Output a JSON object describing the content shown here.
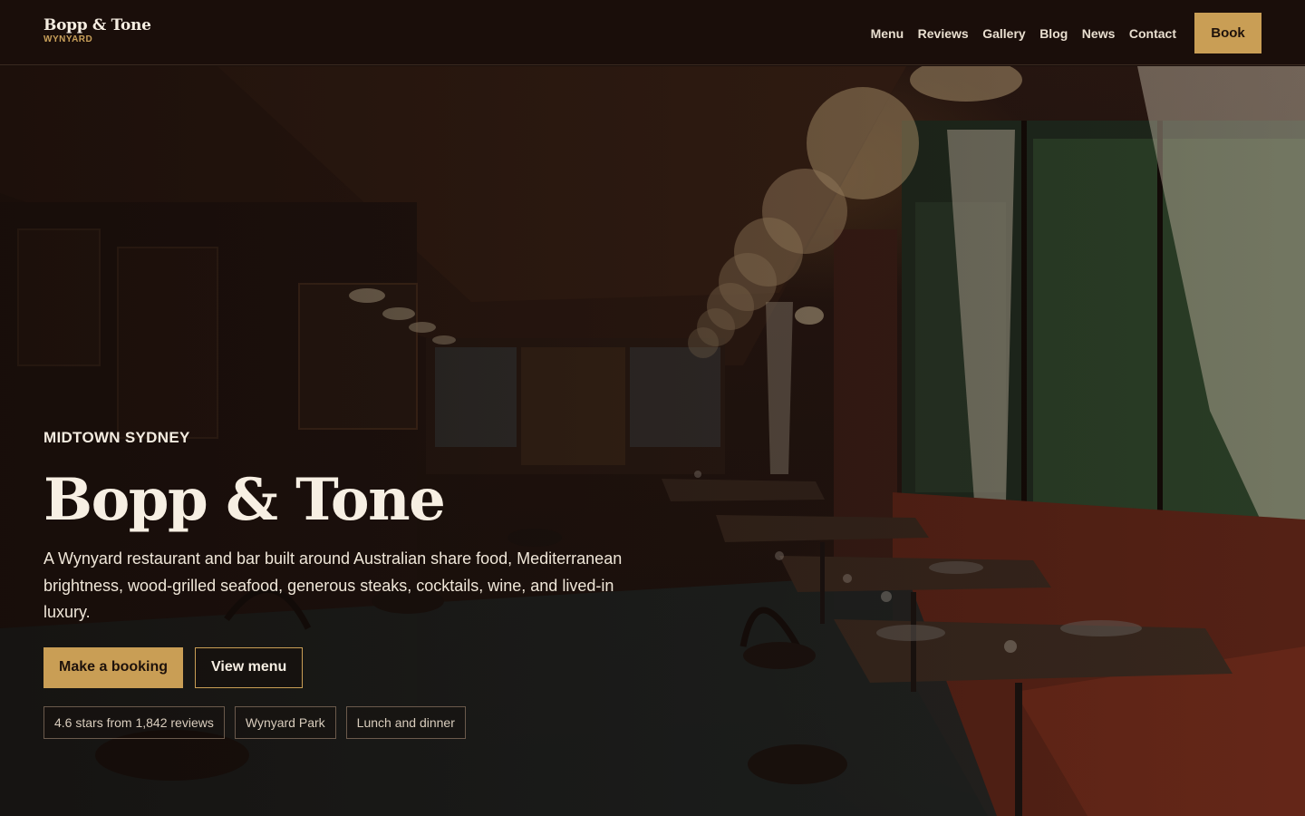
{
  "header": {
    "brand_name": "Bopp & Tone",
    "brand_location": "WYNYARD",
    "nav": [
      "Menu",
      "Reviews",
      "Gallery",
      "Blog",
      "News",
      "Contact"
    ],
    "book_label": "Book"
  },
  "hero": {
    "eyebrow": "MIDTOWN SYDNEY",
    "title": "Bopp & Tone",
    "description": "A Wynyard restaurant and bar built around Australian share food, Mediterranean brightness, wood-grilled seafood, generous steaks, cocktails, wine, and lived-in luxury.",
    "primary_cta": "Make a booking",
    "secondary_cta": "View menu",
    "chips": [
      "4.6 stars from 1,842 reviews",
      "Wynyard Park",
      "Lunch and dinner"
    ],
    "background_image": "restaurant-interior-photo"
  },
  "colors": {
    "accent": "#c99e55",
    "header_bg": "#1a0e0a",
    "text_light": "#f4ece0"
  }
}
